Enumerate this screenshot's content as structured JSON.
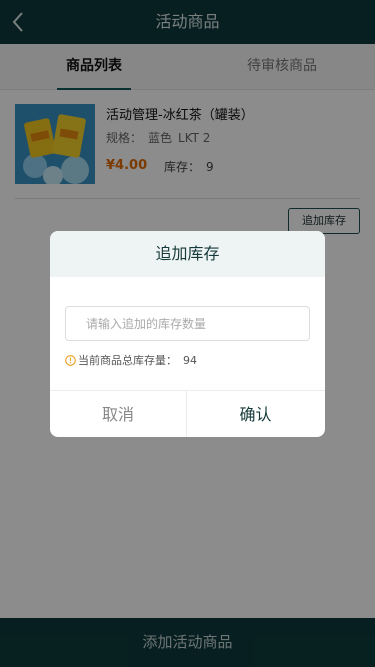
{
  "header": {
    "title": "活动商品",
    "back_icon": "chevron-left-icon"
  },
  "tabs": [
    {
      "label": "商品列表",
      "active": true
    },
    {
      "label": "待审核商品",
      "active": false
    }
  ],
  "product": {
    "name": "活动管理-冰红茶（罐装）",
    "spec_label": "规格：",
    "spec_color": "蓝色",
    "spec_model": "LKT 2",
    "price": "¥4.00",
    "stock_label": "库存：",
    "stock_value": "9",
    "restock_button": "追加库存"
  },
  "modal": {
    "title": "追加库存",
    "input_placeholder": "请输入追加的库存数量",
    "input_value": "",
    "note_label": "当前商品总库存量：",
    "note_value": "94",
    "cancel": "取消",
    "confirm": "确认"
  },
  "footer": {
    "button": "添加活动商品"
  },
  "colors": {
    "brand": "#0d3a3b",
    "price": "#e06a00",
    "warning": "#f0a020"
  }
}
